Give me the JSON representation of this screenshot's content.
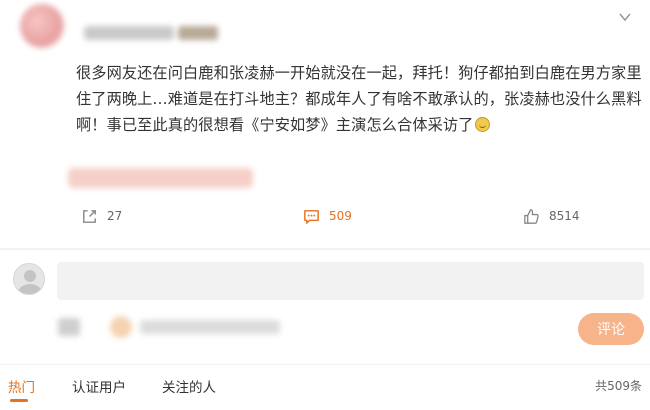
{
  "post": {
    "text": "很多网友还在问白鹿和张凌赫一开始就没在一起，拜托！狗仔都拍到白鹿在男方家里住了两晚上…难道是在打斗地主？都成年人了有啥不敢承认的，张凌赫也没什么黑料啊！事已至此真的很想看《宁安如梦》主演怎么合体采访了"
  },
  "actions": {
    "share_count": "27",
    "comment_count": "509",
    "like_count": "8514"
  },
  "comment_box": {
    "value": "",
    "button_label": "评论"
  },
  "tabs": {
    "hot": "热门",
    "verified": "认证用户",
    "following": "关注的人"
  },
  "footer": {
    "total": "共509条"
  },
  "colors": {
    "accent": "#e6711e",
    "button": "#f7b48a"
  }
}
